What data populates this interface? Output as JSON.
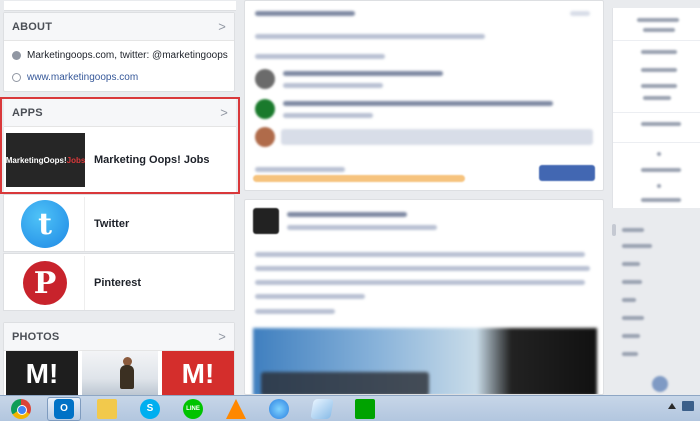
{
  "about": {
    "title": "ABOUT",
    "items": [
      {
        "text": "Marketingoops.com, twitter: @marketingoops",
        "icon": "info-icon"
      },
      {
        "text": "www.marketingoops.com",
        "icon": "globe-icon"
      }
    ]
  },
  "apps": {
    "title": "APPS",
    "items": [
      {
        "label": "Marketing Oops! Jobs",
        "thumb_text": "MarketingOops!",
        "thumb_text_red": "Jobs"
      },
      {
        "label": "Twitter",
        "thumb_glyph": "t"
      },
      {
        "label": "Pinterest",
        "thumb_glyph": "P"
      }
    ]
  },
  "photos": {
    "title": "PHOTOS",
    "items": [
      {
        "glyph": "M!"
      },
      {
        "glyph": ""
      },
      {
        "glyph": "M!"
      }
    ]
  },
  "chevron": ">",
  "taskbar": {
    "apps": [
      {
        "name": "chrome-icon",
        "active": false
      },
      {
        "name": "outlook-icon",
        "active": true,
        "glyph": "O"
      },
      {
        "name": "file-explorer-icon",
        "active": false
      },
      {
        "name": "skype-icon",
        "active": false,
        "glyph": "S"
      },
      {
        "name": "line-icon",
        "active": false,
        "glyph": "LINE"
      },
      {
        "name": "vlc-icon",
        "active": false
      },
      {
        "name": "itunes-icon",
        "active": false
      },
      {
        "name": "notepad-icon",
        "active": false
      },
      {
        "name": "windows-store-icon",
        "active": false
      }
    ]
  },
  "colors": {
    "highlight": "#d9383a",
    "link": "#365899",
    "taskbar": "#b8cce4"
  }
}
